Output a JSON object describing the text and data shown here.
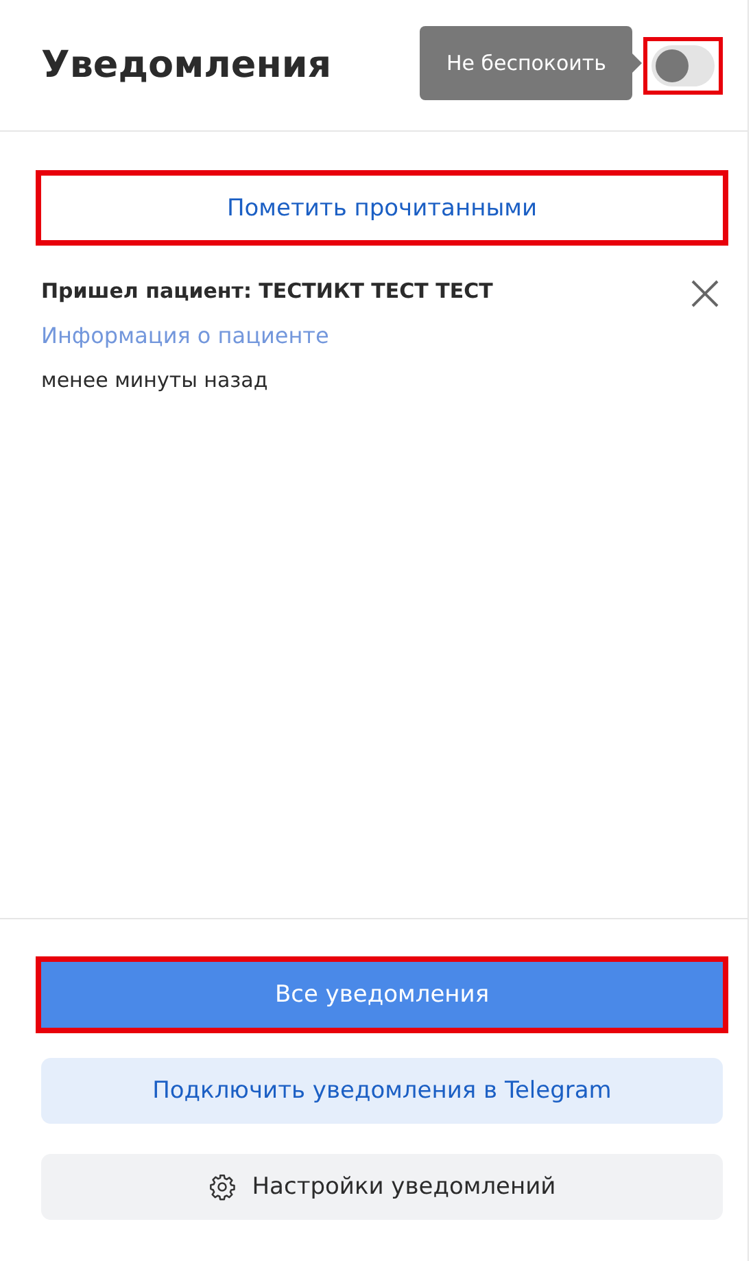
{
  "header": {
    "title": "Уведомления",
    "dnd_tooltip": "Не беспокоить",
    "dnd_toggle": {
      "on": false,
      "highlighted": true
    }
  },
  "mark_read": {
    "label": "Пометить прочитанными",
    "highlighted": true
  },
  "notifications": [
    {
      "title": "Пришел пациент: ТЕСТИКТ ТЕСТ ТЕСТ",
      "link": "Информация о пациенте",
      "time": "менее минуты назад"
    }
  ],
  "footer_buttons": [
    {
      "kind": "primary",
      "label": "Все уведомления",
      "highlighted": true
    },
    {
      "kind": "secondary",
      "label": "Подключить уведомления в Telegram",
      "highlighted": false
    },
    {
      "kind": "settings",
      "label": "Настройки уведомлений",
      "highlighted": false
    }
  ]
}
